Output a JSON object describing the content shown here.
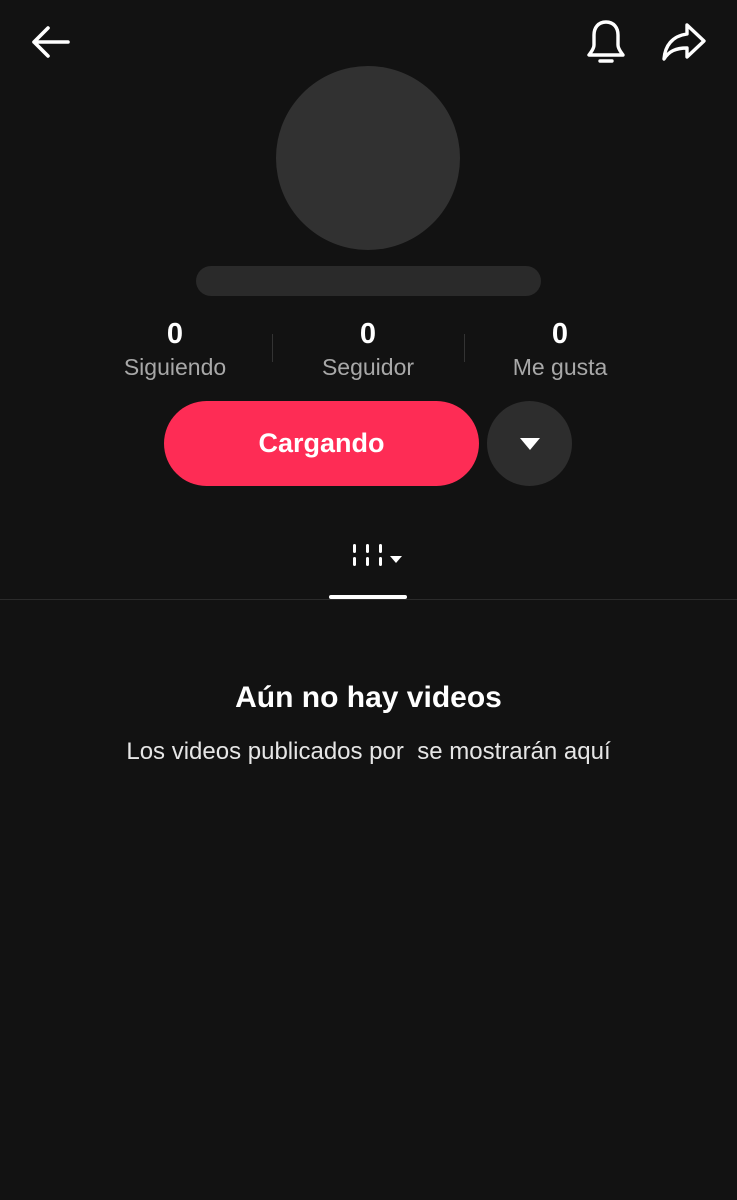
{
  "header": {
    "back_icon": "arrow-left-icon",
    "bell_icon": "bell-icon",
    "share_icon": "share-arrow-icon"
  },
  "profile": {
    "stats": [
      {
        "value": "0",
        "label": "Siguiendo"
      },
      {
        "value": "0",
        "label": "Seguidor"
      },
      {
        "value": "0",
        "label": "Me gusta"
      }
    ]
  },
  "actions": {
    "primary_label": "Cargando",
    "primary_color": "#fe2c55",
    "more_icon": "caret-down-icon"
  },
  "tabs": {
    "videos_icon": "videos-grid-icon"
  },
  "empty_state": {
    "title": "Aún no hay videos",
    "description": "Los videos publicados por  se mostrarán aquí"
  }
}
